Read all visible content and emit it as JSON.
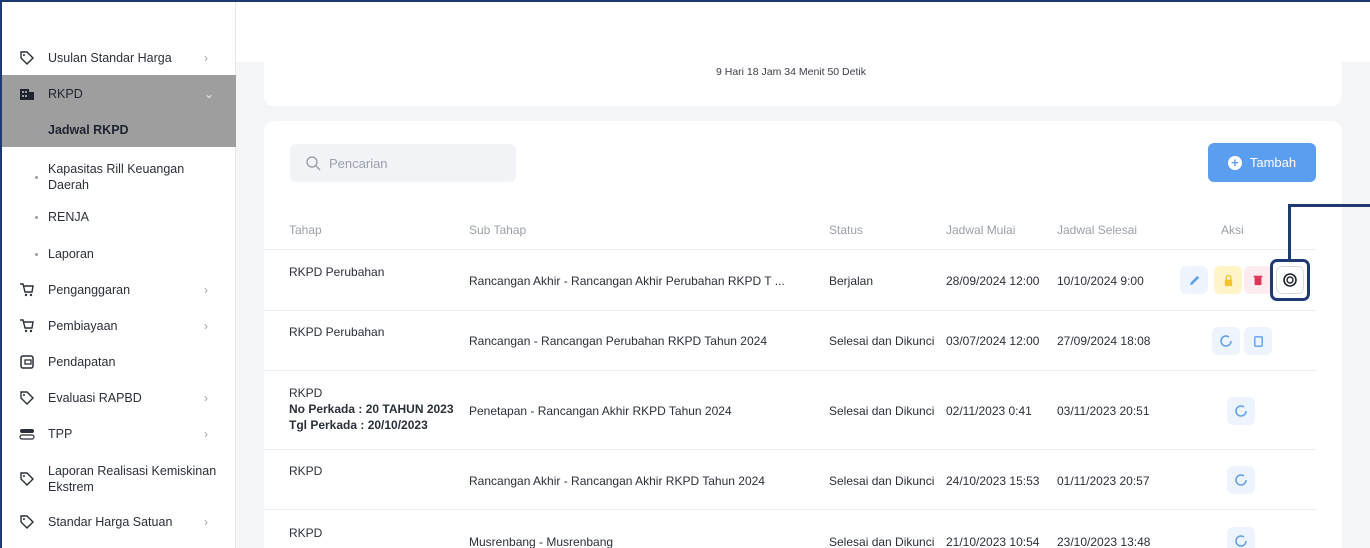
{
  "sidebar": {
    "items": [
      {
        "label": "Usulan Standar Harga",
        "chevron": "›",
        "icon": "tag-icon"
      },
      {
        "label": "RKPD",
        "chevron": "⌄",
        "icon": "building-icon"
      },
      {
        "label": "Jadwal RKPD"
      },
      {
        "label": "Kapasitas Rill Keuangan",
        "label2": "Daerah"
      },
      {
        "label": "RENJA"
      },
      {
        "label": "Laporan"
      },
      {
        "label": "Penganggaran",
        "chevron": "›",
        "icon": "cart-icon"
      },
      {
        "label": "Pembiayaan",
        "chevron": "›",
        "icon": "cart-icon"
      },
      {
        "label": "Pendapatan",
        "icon": "wallet-icon"
      },
      {
        "label": "Evaluasi RAPBD",
        "chevron": "›",
        "icon": "tag-icon"
      },
      {
        "label": "TPP",
        "chevron": "›",
        "icon": "toggle-icon"
      },
      {
        "label": "Laporan Realisasi Kemiskinan",
        "label2": "Ekstrem",
        "icon": "tag-icon"
      },
      {
        "label": "Standar Harga Satuan",
        "chevron": "›",
        "icon": "tag-icon"
      }
    ]
  },
  "countdown": "9 Hari 18 Jam 34 Menit 50 Detik",
  "search": {
    "placeholder": "Pencarian"
  },
  "add_button": "Tambah",
  "table": {
    "headers": [
      "Tahap",
      "Sub Tahap",
      "Status",
      "Jadwal Mulai",
      "Jadwal Selesai",
      "Aksi"
    ],
    "rows": [
      {
        "tahap": "RKPD Perubahan",
        "sub": "Rancangan Akhir - Rancangan Akhir Perubahan RKPD T ...",
        "status": "Berjalan",
        "mulai": "28/09/2024 12:00",
        "selesai": "10/10/2024 9:00"
      },
      {
        "tahap": "RKPD Perubahan",
        "sub": "Rancangan - Rancangan Perubahan RKPD Tahun 2024",
        "status": "Selesai dan Dikunci",
        "mulai": "03/07/2024 12:00",
        "selesai": "27/09/2024 18:08"
      },
      {
        "tahap": "RKPD",
        "perkada_no": "No Perkada : 20 TAHUN 2023",
        "perkada_tgl": "Tgl Perkada : 20/10/2023",
        "sub": "Penetapan - Rancangan Akhir RKPD Tahun 2024",
        "status": "Selesai dan Dikunci",
        "mulai": "02/11/2023 0:41",
        "selesai": "03/11/2023 20:51"
      },
      {
        "tahap": "RKPD",
        "sub": "Rancangan Akhir - Rancangan Akhir RKPD Tahun 2024",
        "status": "Selesai dan Dikunci",
        "mulai": "24/10/2023 15:53",
        "selesai": "01/11/2023 20:57"
      },
      {
        "tahap": "RKPD",
        "sub": "Musrenbang - Musrenbang",
        "status": "Selesai dan Dikunci",
        "mulai": "21/10/2023 10:54",
        "selesai": "23/10/2023 13:48"
      }
    ]
  },
  "colors": {
    "accent": "#5b9ef0",
    "highlight": "#1f3a72",
    "active_bg": "#9e9e9e"
  }
}
